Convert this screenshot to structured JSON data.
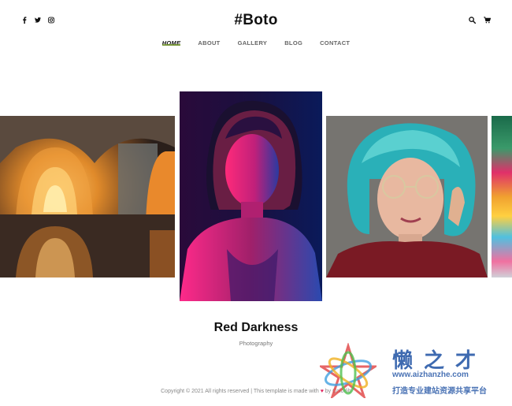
{
  "header": {
    "brand": "#Boto",
    "social_icons": [
      "facebook-icon",
      "twitter-icon",
      "instagram-icon"
    ],
    "tool_icons": [
      "search-icon",
      "cart-icon"
    ]
  },
  "nav": {
    "items": [
      {
        "label": "HOME",
        "active": true
      },
      {
        "label": "ABOUT",
        "active": false
      },
      {
        "label": "GALLERY",
        "active": false
      },
      {
        "label": "BLOG",
        "active": false
      },
      {
        "label": "CONTACT",
        "active": false
      }
    ]
  },
  "slider": {
    "slides": [
      "arched-corridor-photo",
      "red-darkness-portrait",
      "teal-hair-portrait",
      "colorful-abstract-photo"
    ],
    "active_index": 1
  },
  "caption": {
    "title": "Red Darkness",
    "category": "Photography"
  },
  "footer": {
    "text_before": "Copyright © 2021 All rights reserved | This template is made with ",
    "text_after": " by Colorlib"
  },
  "watermark": {
    "chinese_name": "懒之才",
    "url": "www.aizhanzhe.com",
    "slogan": "打造专业建站资源共享平台"
  },
  "colors": {
    "accent": "#6b8e23",
    "heart": "#e0245e",
    "watermark": "#2a5aa8"
  }
}
